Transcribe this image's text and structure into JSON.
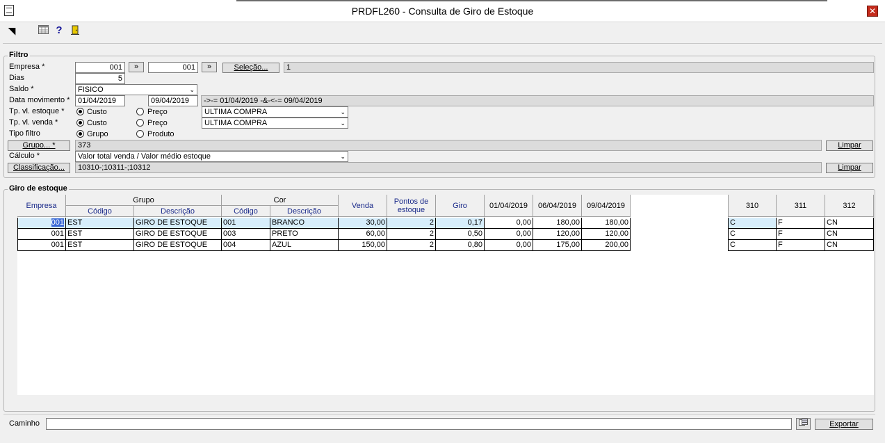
{
  "window": {
    "title": "PRDFL260 - Consulta de Giro de Estoque",
    "close": "✕"
  },
  "toolbar": [
    "pointer-icon",
    "calendar-grid-icon",
    "help-icon",
    "exit-door-icon"
  ],
  "filtro": {
    "legend": "Filtro",
    "empresa": {
      "label": "Empresa *",
      "from": "001",
      "to": "001",
      "arrow": "»",
      "selecao_label": "Seleção...",
      "selecao_value": "1"
    },
    "dias": {
      "label": "Dias",
      "value": "5"
    },
    "saldo": {
      "label": "Saldo *",
      "value": "FISICO"
    },
    "data_movimento": {
      "label": "Data movimento *",
      "from": "01/04/2019",
      "to": "09/04/2019",
      "expr": "->-= 01/04/2019 -&-<-= 09/04/2019"
    },
    "tp_vl_estoque": {
      "label": "Tp. vl. estoque *",
      "opt1": "Custo",
      "opt2": "Preço",
      "select": "ULTIMA COMPRA"
    },
    "tp_vl_venda": {
      "label": "Tp. vl. venda *",
      "opt1": "Custo",
      "opt2": "Preço",
      "select": "ULTIMA COMPRA"
    },
    "tipo_filtro": {
      "label": "Tipo filtro",
      "opt1": "Grupo",
      "opt2": "Produto"
    },
    "grupo": {
      "button": "Grupo... *",
      "value": "373",
      "limpar": "Limpar"
    },
    "calculo": {
      "label": "Cálculo *",
      "value": "Valor total venda / Valor médio estoque"
    },
    "classificacao": {
      "button": "Classificação...",
      "value": "10310-;10311-;10312",
      "limpar": "Limpar"
    }
  },
  "giro": {
    "legend": "Giro de estoque",
    "headers": {
      "empresa": "Empresa",
      "grupo": "Grupo",
      "grupo_codigo": "Código",
      "grupo_descricao": "Descrição",
      "cor": "Cor",
      "cor_codigo": "Código",
      "cor_descricao": "Descrição",
      "venda": "Venda",
      "pontos": "Pontos de estoque",
      "giro": "Giro",
      "d1": "01/04/2019",
      "d2": "06/04/2019",
      "d3": "09/04/2019",
      "c310": "310",
      "c311": "311",
      "c312": "312"
    },
    "rows": [
      {
        "empresa": "001",
        "gcod": "EST",
        "gdesc": "GIRO DE ESTOQUE",
        "ccod": "001",
        "cdesc": "BRANCO",
        "venda": "30,00",
        "pontos": "2",
        "giro": "0,17",
        "d1": "0,00",
        "d2": "180,00",
        "d3": "180,00",
        "c310": "C",
        "c311": "F",
        "c312": "CN"
      },
      {
        "empresa": "001",
        "gcod": "EST",
        "gdesc": "GIRO DE ESTOQUE",
        "ccod": "003",
        "cdesc": "PRETO",
        "venda": "60,00",
        "pontos": "2",
        "giro": "0,50",
        "d1": "0,00",
        "d2": "120,00",
        "d3": "120,00",
        "c310": "C",
        "c311": "F",
        "c312": "CN"
      },
      {
        "empresa": "001",
        "gcod": "EST",
        "gdesc": "GIRO DE ESTOQUE",
        "ccod": "004",
        "cdesc": "AZUL",
        "venda": "150,00",
        "pontos": "2",
        "giro": "0,80",
        "d1": "0,00",
        "d2": "175,00",
        "d3": "200,00",
        "c310": "C",
        "c311": "F",
        "c312": "CN"
      }
    ]
  },
  "footer": {
    "caminho_label": "Caminho",
    "caminho_value": "",
    "exportar": "Exportar"
  },
  "colors": {
    "accent_header_text": "#1a2a8a",
    "selection": "#3d6ad6",
    "close": "#c42b1c"
  }
}
